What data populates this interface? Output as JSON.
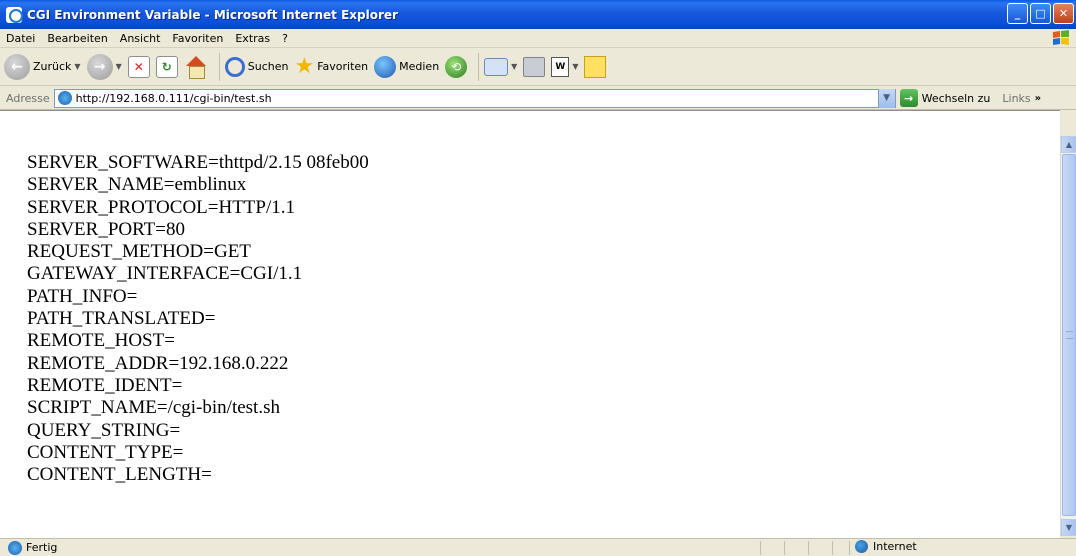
{
  "window": {
    "title": "CGI Environment Variable - Microsoft Internet Explorer"
  },
  "menu": [
    "Datei",
    "Bearbeiten",
    "Ansicht",
    "Favoriten",
    "Extras",
    "?"
  ],
  "toolbar": {
    "back_label": "Zurück",
    "search_label": "Suchen",
    "favorites_label": "Favoriten",
    "media_label": "Medien"
  },
  "address": {
    "label": "Adresse",
    "url": "http://192.168.0.111/cgi-bin/test.sh",
    "go_label": "Wechseln zu",
    "links_label": "Links"
  },
  "content": {
    "lines": [
      "SERVER_SOFTWARE=thttpd/2.15 08feb00",
      "SERVER_NAME=emblinux",
      "SERVER_PROTOCOL=HTTP/1.1",
      "SERVER_PORT=80",
      "REQUEST_METHOD=GET",
      "GATEWAY_INTERFACE=CGI/1.1",
      "PATH_INFO=",
      "PATH_TRANSLATED=",
      "REMOTE_HOST=",
      "REMOTE_ADDR=192.168.0.222",
      "REMOTE_IDENT=",
      "SCRIPT_NAME=/cgi-bin/test.sh",
      "QUERY_STRING=",
      "CONTENT_TYPE=",
      "CONTENT_LENGTH="
    ]
  },
  "status": {
    "text": "Fertig",
    "zone": "Internet"
  }
}
